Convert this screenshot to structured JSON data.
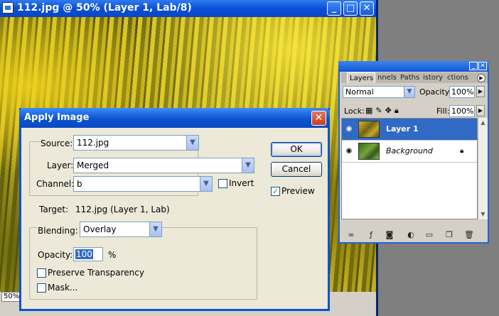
{
  "document_window": {
    "title": "112.jpg @ 50% (Layer 1, Lab/8)",
    "zoom": "50%"
  },
  "layers_palette": {
    "tabs": [
      "Layers",
      "nnels",
      "Paths",
      "istory",
      "ctions"
    ],
    "blend_mode": "Normal",
    "opacity_label": "Opacity:",
    "opacity_value": "100%",
    "lock_label": "Lock:",
    "fill_label": "Fill:",
    "fill_value": "100%",
    "layers": [
      {
        "name": "Layer 1",
        "selected": true,
        "visible": true,
        "locked": false
      },
      {
        "name": "Background",
        "selected": false,
        "visible": true,
        "locked": true
      }
    ]
  },
  "dialog": {
    "title": "Apply Image",
    "source_label": "Source:",
    "source_value": "112.jpg",
    "layer_label": "Layer:",
    "layer_value": "Merged",
    "channel_label": "Channel:",
    "channel_value": "b",
    "invert_label": "Invert",
    "invert_checked": false,
    "target_label": "Target:",
    "target_value": "112.jpg (Layer 1, Lab)",
    "blending_label": "Blending:",
    "blending_value": "Overlay",
    "opacity_label": "Opacity:",
    "opacity_value": "100",
    "opacity_unit": "%",
    "preserve_transparency_label": "Preserve Transparency",
    "preserve_transparency_checked": false,
    "mask_label": "Mask...",
    "mask_checked": false,
    "ok_label": "OK",
    "cancel_label": "Cancel",
    "preview_label": "Preview",
    "preview_checked": true
  }
}
